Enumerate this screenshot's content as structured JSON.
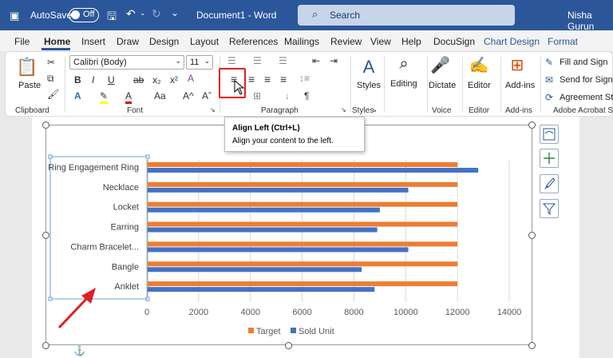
{
  "titlebar": {
    "autosave_label": "AutoSave",
    "autosave_state": "Off",
    "doc_name": "Document1 - Word",
    "search_placeholder": "Search",
    "user": "Nisha Gurun"
  },
  "menu": {
    "tabs": [
      "File",
      "Home",
      "Insert",
      "Draw",
      "Design",
      "Layout",
      "References",
      "Mailings",
      "Review",
      "View",
      "Help",
      "DocuSign",
      "Chart Design",
      "Format"
    ],
    "active": "Home"
  },
  "ribbon": {
    "font_name": "Calibri (Body)",
    "font_size": "11",
    "paste": "Paste",
    "styles": "Styles",
    "editing": "Editing",
    "dictate": "Dictate",
    "editor": "Editor",
    "addins": "Add-ins",
    "fill_sign": "Fill and Sign",
    "send_sig": "Send for Signat",
    "agreement": "Agreement Stat",
    "groups": {
      "clipboard": "Clipboard",
      "font": "Font",
      "paragraph": "Paragraph",
      "styles": "Styles",
      "voice": "Voice",
      "editor": "Editor",
      "addins": "Add-ins",
      "acrobat": "Adobe Acrobat Si"
    }
  },
  "tooltip": {
    "title": "Align Left (Ctrl+L)",
    "desc": "Align your content to the left."
  },
  "colors": {
    "title_bg": "#2b579a",
    "target": "#ed7d31",
    "sold": "#4472c4",
    "arrow": "#e02020"
  },
  "chart_data": {
    "type": "bar",
    "orientation": "horizontal",
    "categories": [
      "Ring Engagement Ring",
      "Necklace",
      "Locket",
      "Earring",
      "Charm Bracelet...",
      "Bangle",
      "Anklet"
    ],
    "series": [
      {
        "name": "Target",
        "values": [
          12000,
          12000,
          12000,
          12000,
          12000,
          12000,
          12000
        ]
      },
      {
        "name": "Sold Unit",
        "values": [
          12800,
          10100,
          9000,
          8900,
          10100,
          8300,
          8800
        ]
      }
    ],
    "xlim": [
      0,
      14000
    ],
    "xticks": [
      "0",
      "2000",
      "4000",
      "6000",
      "8000",
      "10000",
      "12000",
      "14000"
    ],
    "grid": true,
    "legend": "bottom"
  }
}
